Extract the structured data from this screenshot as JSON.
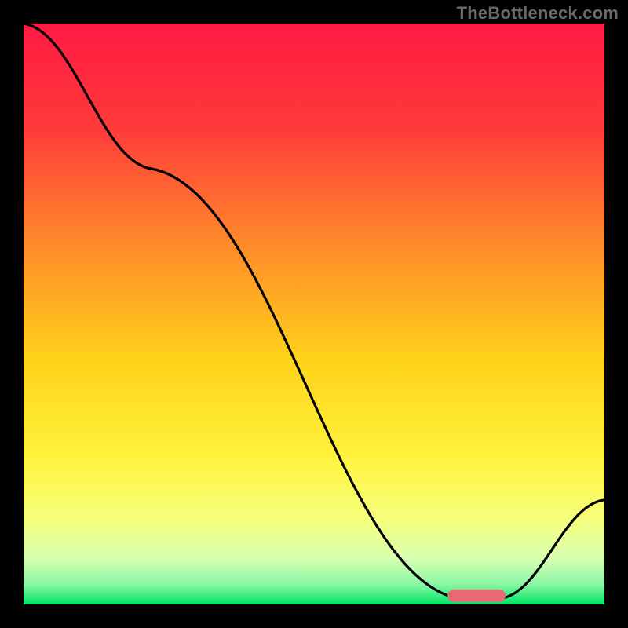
{
  "watermark": "TheBottleneck.com",
  "chart_data": {
    "type": "line",
    "title": "",
    "xlabel": "",
    "ylabel": "",
    "xlim": [
      0,
      100
    ],
    "ylim": [
      0,
      100
    ],
    "series": [
      {
        "name": "curve",
        "x": [
          0,
          22,
          75,
          82,
          100
        ],
        "values": [
          100,
          75,
          1,
          1,
          18
        ]
      }
    ],
    "marker": {
      "name": "optimal-range",
      "x_start": 73,
      "x_end": 83,
      "y": 1.5,
      "color": "#e76a77"
    },
    "gradient_stops": [
      {
        "offset": 0.0,
        "color": "#ff1a44"
      },
      {
        "offset": 0.18,
        "color": "#ff3a3a"
      },
      {
        "offset": 0.38,
        "color": "#ff8a2a"
      },
      {
        "offset": 0.58,
        "color": "#ffd21a"
      },
      {
        "offset": 0.74,
        "color": "#fff23a"
      },
      {
        "offset": 0.85,
        "color": "#f7ff7a"
      },
      {
        "offset": 0.92,
        "color": "#d8ffb0"
      },
      {
        "offset": 0.965,
        "color": "#8cf7a6"
      },
      {
        "offset": 1.0,
        "color": "#00e565"
      }
    ]
  }
}
